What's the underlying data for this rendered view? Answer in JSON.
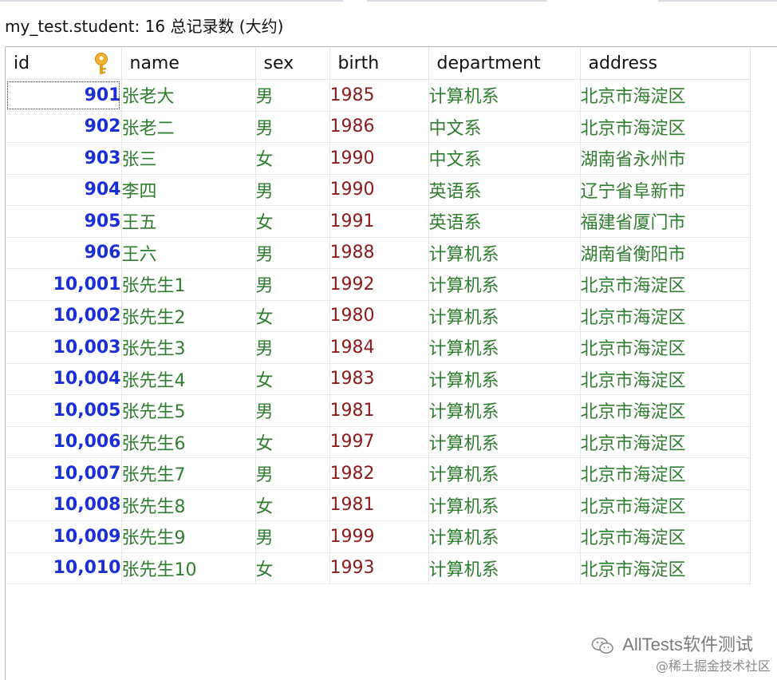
{
  "status": {
    "text": "my_test.student: 16 总记录数 (大约)"
  },
  "columns": [
    {
      "key": "id",
      "label": "id"
    },
    {
      "key": "name",
      "label": "name"
    },
    {
      "key": "sex",
      "label": "sex"
    },
    {
      "key": "birth",
      "label": "birth"
    },
    {
      "key": "department",
      "label": "department"
    },
    {
      "key": "address",
      "label": "address"
    }
  ],
  "rows": [
    {
      "id": "901",
      "name": "张老大",
      "sex": "男",
      "birth": "1985",
      "department": "计算机系",
      "address": "北京市海淀区"
    },
    {
      "id": "902",
      "name": "张老二",
      "sex": "男",
      "birth": "1986",
      "department": "中文系",
      "address": "北京市海淀区"
    },
    {
      "id": "903",
      "name": "张三",
      "sex": "女",
      "birth": "1990",
      "department": "中文系",
      "address": "湖南省永州市"
    },
    {
      "id": "904",
      "name": "李四",
      "sex": "男",
      "birth": "1990",
      "department": "英语系",
      "address": "辽宁省阜新市"
    },
    {
      "id": "905",
      "name": "王五",
      "sex": "女",
      "birth": "1991",
      "department": "英语系",
      "address": "福建省厦门市"
    },
    {
      "id": "906",
      "name": "王六",
      "sex": "男",
      "birth": "1988",
      "department": "计算机系",
      "address": "湖南省衡阳市"
    },
    {
      "id": "10,001",
      "name": "张先生1",
      "sex": "男",
      "birth": "1992",
      "department": "计算机系",
      "address": "北京市海淀区"
    },
    {
      "id": "10,002",
      "name": "张先生2",
      "sex": "女",
      "birth": "1980",
      "department": "计算机系",
      "address": "北京市海淀区"
    },
    {
      "id": "10,003",
      "name": "张先生3",
      "sex": "男",
      "birth": "1984",
      "department": "计算机系",
      "address": "北京市海淀区"
    },
    {
      "id": "10,004",
      "name": "张先生4",
      "sex": "女",
      "birth": "1983",
      "department": "计算机系",
      "address": "北京市海淀区"
    },
    {
      "id": "10,005",
      "name": "张先生5",
      "sex": "男",
      "birth": "1981",
      "department": "计算机系",
      "address": "北京市海淀区"
    },
    {
      "id": "10,006",
      "name": "张先生6",
      "sex": "女",
      "birth": "1997",
      "department": "计算机系",
      "address": "北京市海淀区"
    },
    {
      "id": "10,007",
      "name": "张先生7",
      "sex": "男",
      "birth": "1982",
      "department": "计算机系",
      "address": "北京市海淀区"
    },
    {
      "id": "10,008",
      "name": "张先生8",
      "sex": "女",
      "birth": "1981",
      "department": "计算机系",
      "address": "北京市海淀区"
    },
    {
      "id": "10,009",
      "name": "张先生9",
      "sex": "男",
      "birth": "1999",
      "department": "计算机系",
      "address": "北京市海淀区"
    },
    {
      "id": "10,010",
      "name": "张先生10",
      "sex": "女",
      "birth": "1993",
      "department": "计算机系",
      "address": "北京市海淀区"
    }
  ],
  "selected_row": 0,
  "primary_key_icon": "key-icon",
  "colors": {
    "id_text": "#1a2fd6",
    "string_text": "#2f7d2f",
    "number_text": "#8b1a1a",
    "key_icon": "#e0a020"
  },
  "watermark": {
    "brand": "AllTests软件测试",
    "icon": "wechat-icon",
    "sub": "@稀土掘金技术社区"
  }
}
